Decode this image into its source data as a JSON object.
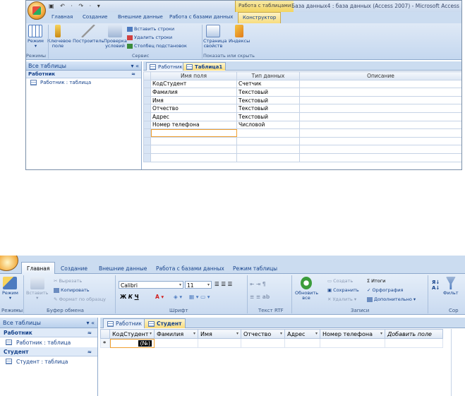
{
  "shot1": {
    "qat": "▣ ↶ · ↷ · ▾",
    "context_tab": "Работа с таблицами",
    "window_title": "База данных4 : база данных (Access 2007) - Microsoft Access",
    "tabs": [
      "Главная",
      "Создание",
      "Внешние данные",
      "Работа с базами данных",
      "Конструктор"
    ],
    "ribbon": {
      "mode_label": "Режим",
      "key_label": "Ключевое поле",
      "builder_label": "Построитель",
      "check_label": "Проверка условий",
      "insert_rows": "Вставить строки",
      "delete_rows": "Удалить строки",
      "lookup_col": "Столбец подстановок",
      "prop_sheet": "Страница свойств",
      "indexes": "Индексы",
      "groups": [
        "Режимы",
        "Сервис",
        "Показать или скрыть"
      ]
    },
    "nav": {
      "header": "Все таблицы",
      "group": "Работник",
      "item": "Работник : таблица"
    },
    "doc_tabs": [
      "Работник",
      "Таблица1"
    ],
    "design": {
      "headers": [
        "Имя поля",
        "Тип данных",
        "Описание"
      ],
      "rows": [
        [
          "КодСтудент",
          "Счетчик",
          ""
        ],
        [
          "Фамилия",
          "Текстовый",
          ""
        ],
        [
          "Имя",
          "Текстовый",
          ""
        ],
        [
          "Отчество",
          "Текстовый",
          ""
        ],
        [
          "Адрес",
          "Текстовый",
          ""
        ],
        [
          "Номер телефона",
          "Числовой",
          ""
        ]
      ]
    }
  },
  "shot2": {
    "tabs": [
      "Главная",
      "Создание",
      "Внешние данные",
      "Работа с базами данных",
      "Режим таблицы"
    ],
    "ribbon": {
      "mode": "Режим",
      "paste": "Вставить",
      "cut": "Вырезать",
      "copy": "Копировать",
      "format_painter": "Формат по образцу",
      "font_name": "Calibri",
      "font_size": "11",
      "refresh": "Обновить все",
      "create": "Создать",
      "totals": "Итоги",
      "save": "Сохранить",
      "spelling": "Орфография",
      "delete": "Удалить",
      "more": "Дополнительно",
      "filter": "Фильт",
      "groups": [
        "Режимы",
        "Буфер обмена",
        "Шрифт",
        "Текст RTF",
        "Записи",
        "Сор"
      ]
    },
    "nav": {
      "header": "Все таблицы",
      "groups": [
        {
          "name": "Работник",
          "item": "Работник : таблица"
        },
        {
          "name": "Студент",
          "item": "Студент : таблица"
        }
      ]
    },
    "doc_tabs": [
      "Работник",
      "Студент"
    ],
    "sheet": {
      "headers": [
        "КодСтудент",
        "Фамилия",
        "Имя",
        "Отчество",
        "Адрес",
        "Номер телефона",
        "Добавить поле"
      ],
      "new_row_marker": "*",
      "new_row_value": "(№)"
    }
  },
  "colors": {
    "accent": "#15428b",
    "ribbon": "#c4d7ef",
    "context": "#f3d561"
  }
}
